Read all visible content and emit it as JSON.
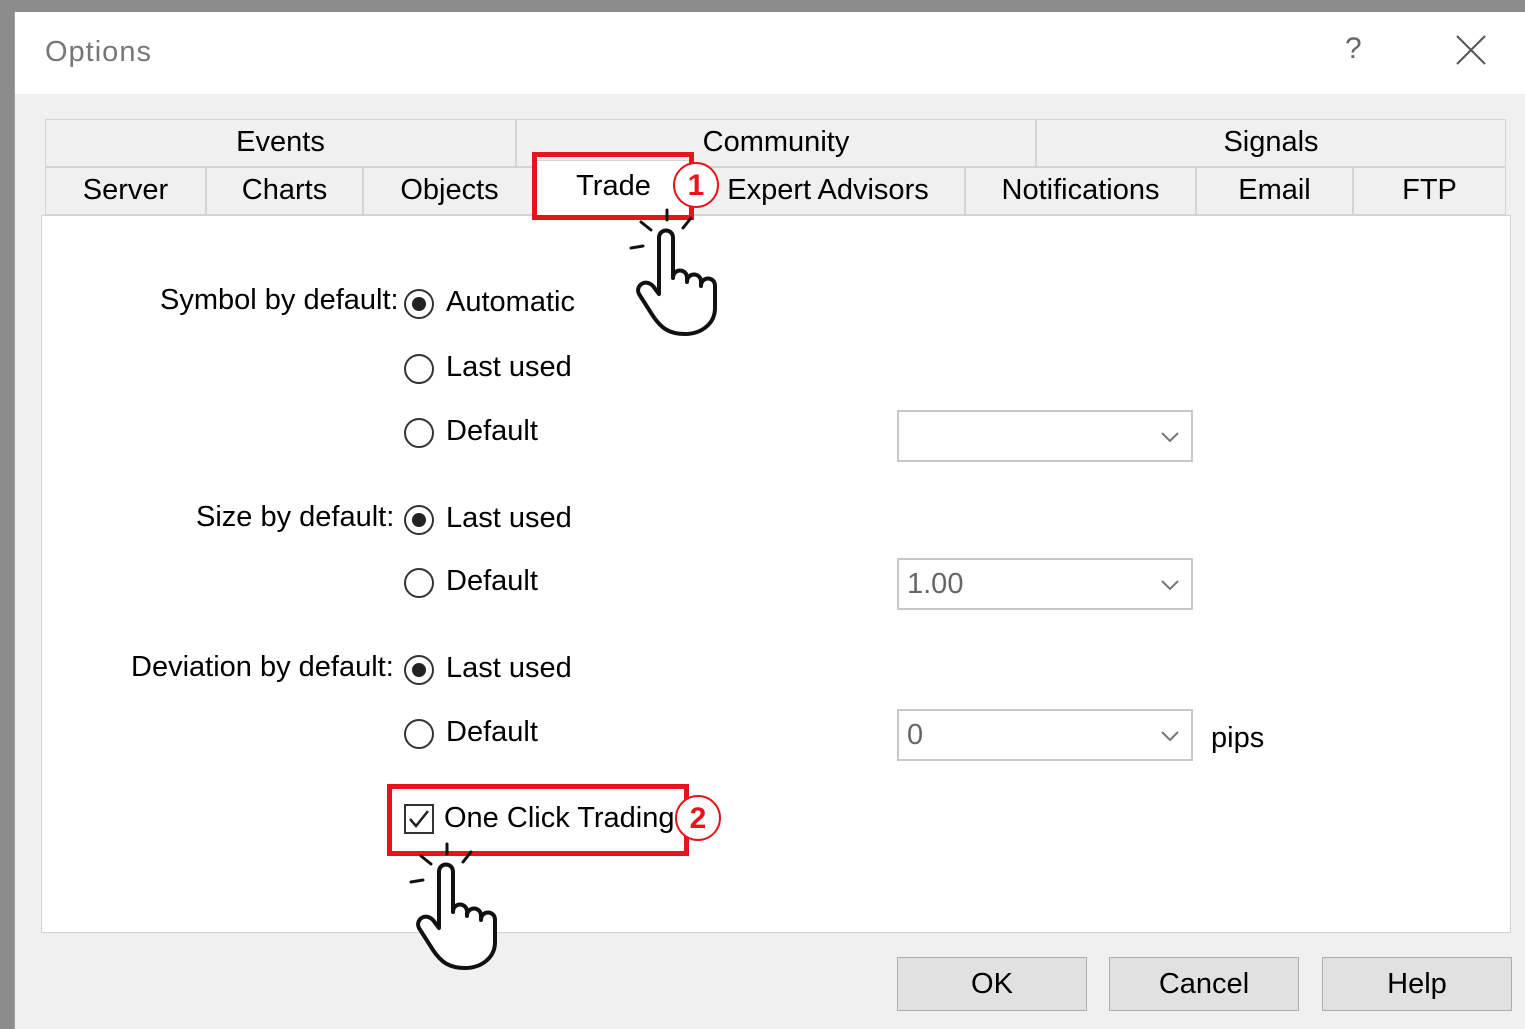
{
  "window": {
    "title": "Options",
    "help_glyph": "?",
    "close_icon": "close-icon"
  },
  "tabs_row1": [
    {
      "label": "Events"
    },
    {
      "label": "Community"
    },
    {
      "label": "Signals"
    }
  ],
  "tabs_row2": [
    {
      "label": "Server"
    },
    {
      "label": "Charts"
    },
    {
      "label": "Objects"
    },
    {
      "label": "Trade",
      "selected": true
    },
    {
      "label": "Expert Advisors"
    },
    {
      "label": "Notifications"
    },
    {
      "label": "Email"
    },
    {
      "label": "FTP"
    }
  ],
  "symbol": {
    "label": "Symbol by default:",
    "options": [
      {
        "label": "Automatic",
        "checked": true
      },
      {
        "label": "Last used",
        "checked": false
      },
      {
        "label": "Default",
        "checked": false
      }
    ],
    "combo_value": ""
  },
  "size": {
    "label": "Size by default:",
    "options": [
      {
        "label": "Last used",
        "checked": true
      },
      {
        "label": "Default",
        "checked": false
      }
    ],
    "combo_value": "1.00"
  },
  "deviation": {
    "label": "Deviation by default:",
    "options": [
      {
        "label": "Last used",
        "checked": true
      },
      {
        "label": "Default",
        "checked": false
      }
    ],
    "combo_value": "0",
    "unit": "pips"
  },
  "one_click": {
    "label": "One Click Trading",
    "checked": true
  },
  "buttons": {
    "ok": "OK",
    "cancel": "Cancel",
    "help": "Help"
  },
  "annotations": [
    {
      "number": "1"
    },
    {
      "number": "2"
    }
  ],
  "colors": {
    "highlight": "#e8141b"
  }
}
